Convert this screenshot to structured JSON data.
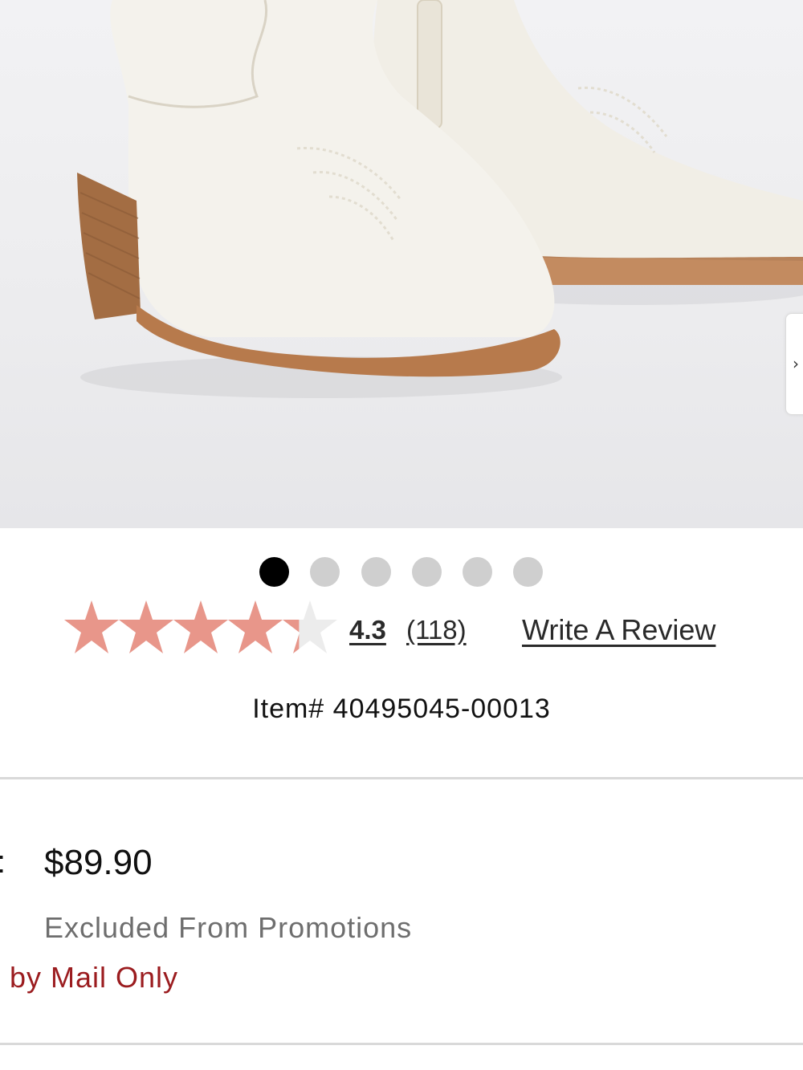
{
  "gallery": {
    "image_alt": "Cream western boots with stacked wooden heel",
    "next_icon": "chevron-right-icon",
    "next_glyph": "›",
    "dots_total": 6,
    "dots_active_index": 0
  },
  "rating": {
    "value": "4.3",
    "count": "(118)",
    "stars_filled_fraction": 0.86,
    "star_color": "#e8968a",
    "write_review_label": "Write A Review"
  },
  "item": {
    "number": "Item# 40495045-00013"
  },
  "price": {
    "colon": ":",
    "amount": "$89.90",
    "note": "Excluded From Promotions",
    "mail_note": "by Mail Only",
    "mail_note_color": "#9b1c1f"
  }
}
